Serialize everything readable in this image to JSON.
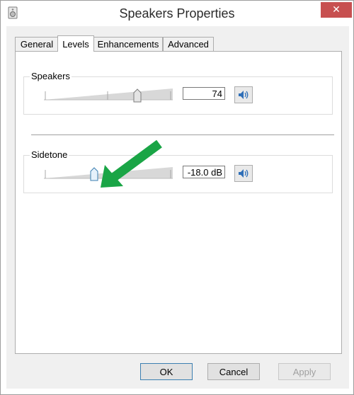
{
  "window": {
    "title": "Speakers Properties",
    "close_glyph": "✕"
  },
  "tabs": [
    {
      "label": "General"
    },
    {
      "label": "Levels"
    },
    {
      "label": "Enhancements"
    },
    {
      "label": "Advanced"
    }
  ],
  "speakers": {
    "label": "Speakers",
    "value": "74",
    "level": 0.74,
    "mute_icon": "speaker-icon"
  },
  "sidetone": {
    "label": "Sidetone",
    "value": "-18.0 dB",
    "mute_icon": "speaker-icon"
  },
  "buttons": {
    "ok": "OK",
    "cancel": "Cancel",
    "apply": "Apply"
  },
  "colors": {
    "close": "#c75050",
    "arrow": "#1aa546",
    "accent": "#3c7fb1"
  }
}
